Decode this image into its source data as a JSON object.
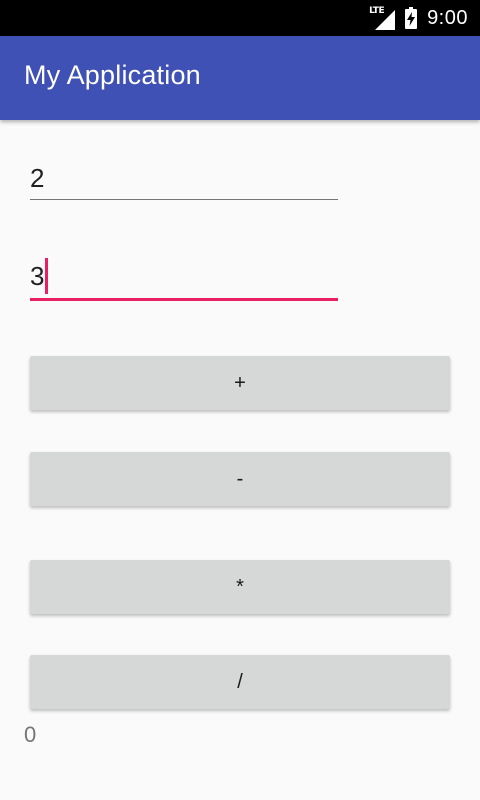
{
  "status_bar": {
    "network_label": "LTE",
    "time": "9:00",
    "icons": [
      "lte-signal-icon",
      "battery-charging-icon"
    ]
  },
  "app_bar": {
    "title": "My Application",
    "color": "#3f51b5"
  },
  "inputs": {
    "first_value": "2",
    "second_value": "3",
    "accent_color": "#e91e63"
  },
  "buttons": {
    "add_label": "+",
    "subtract_label": "-",
    "multiply_label": "*",
    "divide_label": "/"
  },
  "result": {
    "value": "0"
  }
}
